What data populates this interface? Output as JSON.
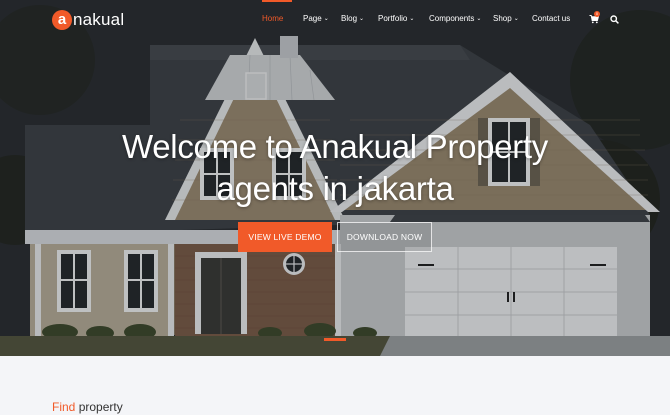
{
  "brand": {
    "logo_letter": "a",
    "logo_rest": "nakual",
    "accent": "#f15a29"
  },
  "nav": {
    "items": [
      {
        "label": "Home",
        "has_menu": false,
        "active": true
      },
      {
        "label": "Page",
        "has_menu": true
      },
      {
        "label": "Blog",
        "has_menu": true
      },
      {
        "label": "Portfolio",
        "has_menu": true
      },
      {
        "label": "Components",
        "has_menu": true
      },
      {
        "label": "Shop",
        "has_menu": true
      },
      {
        "label": "Contact us",
        "has_menu": false
      }
    ],
    "cart_icon": "cart-icon",
    "cart_count": "0",
    "search_icon": "search-icon"
  },
  "hero": {
    "headline_line1": "Welcome to Anakual Property",
    "headline_line2": "agents in jakarta",
    "primary_button": "VIEW LIVE DEMO",
    "secondary_button": "DOWNLOAD NOW"
  },
  "section": {
    "title_accent": "Find",
    "title_rest": "property"
  }
}
